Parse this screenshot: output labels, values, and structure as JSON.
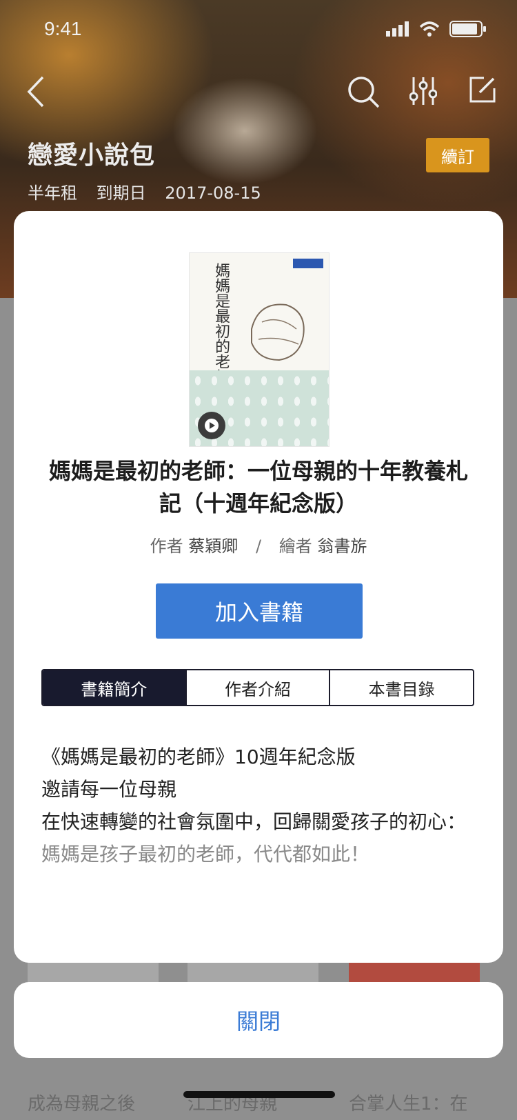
{
  "status_bar": {
    "time": "9:41"
  },
  "header": {
    "title": "戀愛小說包",
    "plan": "半年租",
    "expiry_label": "到期日",
    "expiry_date": "2017-08-15",
    "renew_label": "續訂"
  },
  "icons": {
    "back": "back-chevron-icon",
    "search": "search-icon",
    "filter": "filter-sliders-icon",
    "edit": "edit-icon",
    "play": "play-icon"
  },
  "book": {
    "title": "媽媽是最初的老師：一位母親的十年教養札記（十週年紀念版）",
    "author_label": "作者",
    "author": "蔡穎卿",
    "separator": "/",
    "illustrator_label": "繪者",
    "illustrator": "翁書旂",
    "cover_title": "媽媽是最初的老師",
    "add_label": "加入書籍"
  },
  "tabs": [
    {
      "label": "書籍簡介",
      "active": true
    },
    {
      "label": "作者介紹",
      "active": false
    },
    {
      "label": "本書目錄",
      "active": false
    }
  ],
  "description": [
    "《媽媽是最初的老師》10週年紀念版",
    "邀請每一位母親",
    "在快速轉變的社會氛圍中，回歸關愛孩子的初心：",
    "媽媽是孩子最初的老師，代代都如此！"
  ],
  "background_books": [
    {
      "title": "成為母親之後"
    },
    {
      "title": "江上的母親"
    },
    {
      "title": "合掌人生1：在"
    }
  ],
  "close_label": "關閉",
  "colors": {
    "accent": "#3a7bd5",
    "renew": "#d9951d",
    "active_tab": "#181a2e"
  }
}
